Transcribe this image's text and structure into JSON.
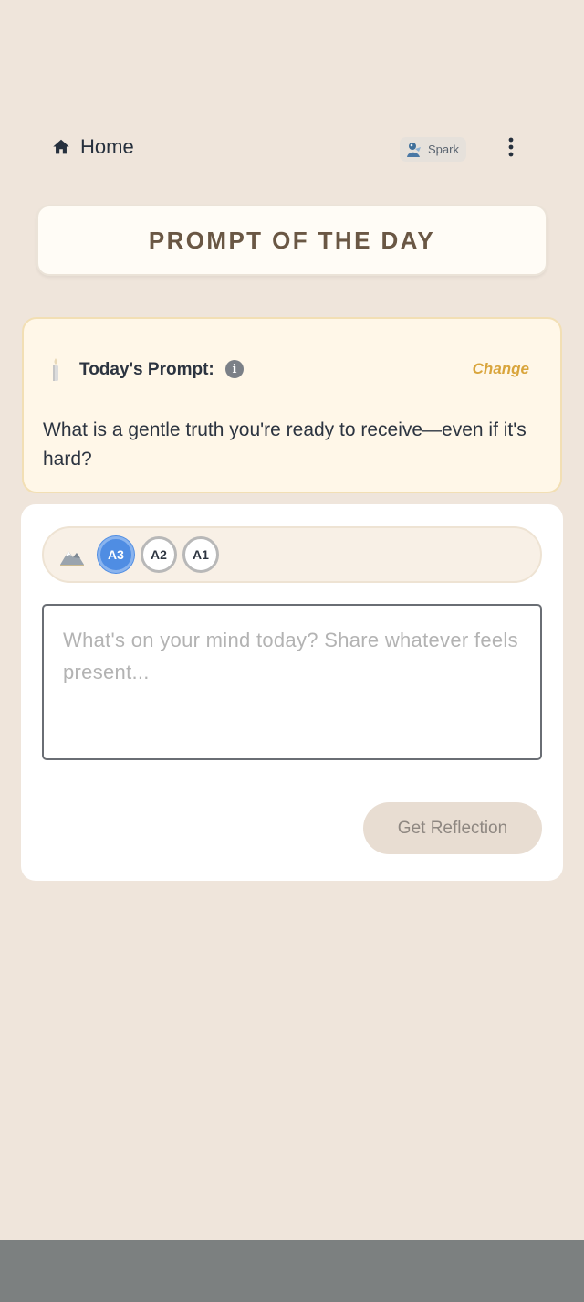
{
  "header": {
    "home_label": "Home",
    "home_icon": "home-icon",
    "spark_label": "Spark",
    "spark_icon": "spark-avatar-icon",
    "more_icon": "more-vertical-icon"
  },
  "banner": {
    "title": "PROMPT OF THE DAY"
  },
  "prompt_card": {
    "icon": "candle-icon",
    "label": "Today's Prompt:",
    "info_icon": "info-icon",
    "change_label": "Change",
    "prompt_text": "What is a gentle truth you're ready to receive—even if it's hard?"
  },
  "reflection": {
    "mode_icon": "mountain-icon",
    "levels": [
      {
        "label": "A3",
        "selected": true
      },
      {
        "label": "A2",
        "selected": false
      },
      {
        "label": "A1",
        "selected": false
      }
    ],
    "input_value": "",
    "input_placeholder": "What's on your mind today? Share whatever feels present...",
    "submit_label": "Get Reflection"
  },
  "colors": {
    "background": "#efe5db",
    "accent_blue": "#4f8de3",
    "change_link": "#d9a53c",
    "banner_text": "#6a5744",
    "prompt_card_bg": "#fff7e8"
  }
}
